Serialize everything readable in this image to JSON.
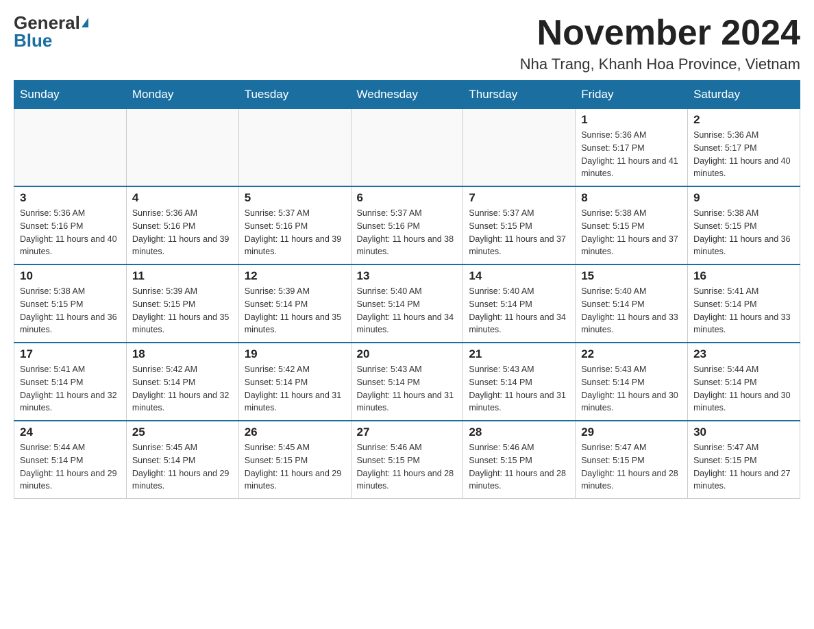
{
  "header": {
    "logo_general": "General",
    "logo_blue": "Blue",
    "month_title": "November 2024",
    "location": "Nha Trang, Khanh Hoa Province, Vietnam"
  },
  "days_of_week": [
    "Sunday",
    "Monday",
    "Tuesday",
    "Wednesday",
    "Thursday",
    "Friday",
    "Saturday"
  ],
  "weeks": [
    [
      {
        "day": "",
        "sunrise": "",
        "sunset": "",
        "daylight": ""
      },
      {
        "day": "",
        "sunrise": "",
        "sunset": "",
        "daylight": ""
      },
      {
        "day": "",
        "sunrise": "",
        "sunset": "",
        "daylight": ""
      },
      {
        "day": "",
        "sunrise": "",
        "sunset": "",
        "daylight": ""
      },
      {
        "day": "",
        "sunrise": "",
        "sunset": "",
        "daylight": ""
      },
      {
        "day": "1",
        "sunrise": "Sunrise: 5:36 AM",
        "sunset": "Sunset: 5:17 PM",
        "daylight": "Daylight: 11 hours and 41 minutes."
      },
      {
        "day": "2",
        "sunrise": "Sunrise: 5:36 AM",
        "sunset": "Sunset: 5:17 PM",
        "daylight": "Daylight: 11 hours and 40 minutes."
      }
    ],
    [
      {
        "day": "3",
        "sunrise": "Sunrise: 5:36 AM",
        "sunset": "Sunset: 5:16 PM",
        "daylight": "Daylight: 11 hours and 40 minutes."
      },
      {
        "day": "4",
        "sunrise": "Sunrise: 5:36 AM",
        "sunset": "Sunset: 5:16 PM",
        "daylight": "Daylight: 11 hours and 39 minutes."
      },
      {
        "day": "5",
        "sunrise": "Sunrise: 5:37 AM",
        "sunset": "Sunset: 5:16 PM",
        "daylight": "Daylight: 11 hours and 39 minutes."
      },
      {
        "day": "6",
        "sunrise": "Sunrise: 5:37 AM",
        "sunset": "Sunset: 5:16 PM",
        "daylight": "Daylight: 11 hours and 38 minutes."
      },
      {
        "day": "7",
        "sunrise": "Sunrise: 5:37 AM",
        "sunset": "Sunset: 5:15 PM",
        "daylight": "Daylight: 11 hours and 37 minutes."
      },
      {
        "day": "8",
        "sunrise": "Sunrise: 5:38 AM",
        "sunset": "Sunset: 5:15 PM",
        "daylight": "Daylight: 11 hours and 37 minutes."
      },
      {
        "day": "9",
        "sunrise": "Sunrise: 5:38 AM",
        "sunset": "Sunset: 5:15 PM",
        "daylight": "Daylight: 11 hours and 36 minutes."
      }
    ],
    [
      {
        "day": "10",
        "sunrise": "Sunrise: 5:38 AM",
        "sunset": "Sunset: 5:15 PM",
        "daylight": "Daylight: 11 hours and 36 minutes."
      },
      {
        "day": "11",
        "sunrise": "Sunrise: 5:39 AM",
        "sunset": "Sunset: 5:15 PM",
        "daylight": "Daylight: 11 hours and 35 minutes."
      },
      {
        "day": "12",
        "sunrise": "Sunrise: 5:39 AM",
        "sunset": "Sunset: 5:14 PM",
        "daylight": "Daylight: 11 hours and 35 minutes."
      },
      {
        "day": "13",
        "sunrise": "Sunrise: 5:40 AM",
        "sunset": "Sunset: 5:14 PM",
        "daylight": "Daylight: 11 hours and 34 minutes."
      },
      {
        "day": "14",
        "sunrise": "Sunrise: 5:40 AM",
        "sunset": "Sunset: 5:14 PM",
        "daylight": "Daylight: 11 hours and 34 minutes."
      },
      {
        "day": "15",
        "sunrise": "Sunrise: 5:40 AM",
        "sunset": "Sunset: 5:14 PM",
        "daylight": "Daylight: 11 hours and 33 minutes."
      },
      {
        "day": "16",
        "sunrise": "Sunrise: 5:41 AM",
        "sunset": "Sunset: 5:14 PM",
        "daylight": "Daylight: 11 hours and 33 minutes."
      }
    ],
    [
      {
        "day": "17",
        "sunrise": "Sunrise: 5:41 AM",
        "sunset": "Sunset: 5:14 PM",
        "daylight": "Daylight: 11 hours and 32 minutes."
      },
      {
        "day": "18",
        "sunrise": "Sunrise: 5:42 AM",
        "sunset": "Sunset: 5:14 PM",
        "daylight": "Daylight: 11 hours and 32 minutes."
      },
      {
        "day": "19",
        "sunrise": "Sunrise: 5:42 AM",
        "sunset": "Sunset: 5:14 PM",
        "daylight": "Daylight: 11 hours and 31 minutes."
      },
      {
        "day": "20",
        "sunrise": "Sunrise: 5:43 AM",
        "sunset": "Sunset: 5:14 PM",
        "daylight": "Daylight: 11 hours and 31 minutes."
      },
      {
        "day": "21",
        "sunrise": "Sunrise: 5:43 AM",
        "sunset": "Sunset: 5:14 PM",
        "daylight": "Daylight: 11 hours and 31 minutes."
      },
      {
        "day": "22",
        "sunrise": "Sunrise: 5:43 AM",
        "sunset": "Sunset: 5:14 PM",
        "daylight": "Daylight: 11 hours and 30 minutes."
      },
      {
        "day": "23",
        "sunrise": "Sunrise: 5:44 AM",
        "sunset": "Sunset: 5:14 PM",
        "daylight": "Daylight: 11 hours and 30 minutes."
      }
    ],
    [
      {
        "day": "24",
        "sunrise": "Sunrise: 5:44 AM",
        "sunset": "Sunset: 5:14 PM",
        "daylight": "Daylight: 11 hours and 29 minutes."
      },
      {
        "day": "25",
        "sunrise": "Sunrise: 5:45 AM",
        "sunset": "Sunset: 5:14 PM",
        "daylight": "Daylight: 11 hours and 29 minutes."
      },
      {
        "day": "26",
        "sunrise": "Sunrise: 5:45 AM",
        "sunset": "Sunset: 5:15 PM",
        "daylight": "Daylight: 11 hours and 29 minutes."
      },
      {
        "day": "27",
        "sunrise": "Sunrise: 5:46 AM",
        "sunset": "Sunset: 5:15 PM",
        "daylight": "Daylight: 11 hours and 28 minutes."
      },
      {
        "day": "28",
        "sunrise": "Sunrise: 5:46 AM",
        "sunset": "Sunset: 5:15 PM",
        "daylight": "Daylight: 11 hours and 28 minutes."
      },
      {
        "day": "29",
        "sunrise": "Sunrise: 5:47 AM",
        "sunset": "Sunset: 5:15 PM",
        "daylight": "Daylight: 11 hours and 28 minutes."
      },
      {
        "day": "30",
        "sunrise": "Sunrise: 5:47 AM",
        "sunset": "Sunset: 5:15 PM",
        "daylight": "Daylight: 11 hours and 27 minutes."
      }
    ]
  ]
}
